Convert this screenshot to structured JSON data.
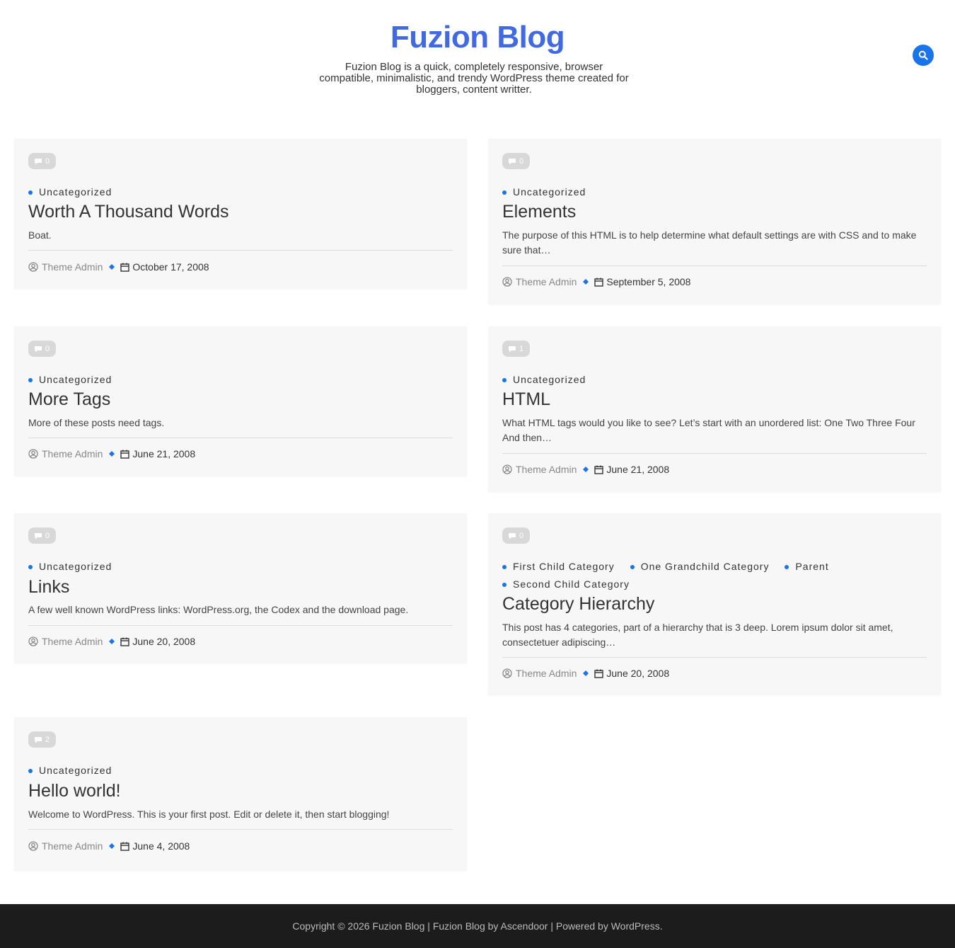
{
  "header": {
    "title": "Fuzion Blog",
    "description": "Fuzion Blog is a quick, completely responsive, browser compatible, minimalistic, and trendy WordPress theme created for bloggers, content writter."
  },
  "posts": [
    {
      "comments": "0",
      "categories": [
        "Uncategorized"
      ],
      "title": "Worth A Thousand Words",
      "excerpt": "Boat.",
      "author": "Theme Admin",
      "date": "October 17, 2008"
    },
    {
      "comments": "0",
      "categories": [
        "Uncategorized"
      ],
      "title": "Elements",
      "excerpt": "The purpose of this HTML is to help determine what default settings are with CSS and to make sure that…",
      "author": "Theme Admin",
      "date": "September 5, 2008"
    },
    {
      "comments": "0",
      "categories": [
        "Uncategorized"
      ],
      "title": "More Tags",
      "excerpt": "More of these posts need tags.",
      "author": "Theme Admin",
      "date": "June 21, 2008"
    },
    {
      "comments": "1",
      "categories": [
        "Uncategorized"
      ],
      "title": "HTML",
      "excerpt": "What HTML tags would you like to see? Let’s start with an unordered list: One Two Three Four And then…",
      "author": "Theme Admin",
      "date": "June 21, 2008"
    },
    {
      "comments": "0",
      "categories": [
        "Uncategorized"
      ],
      "title": "Links",
      "excerpt": "A few well known WordPress links: WordPress.org, the Codex and the download page.",
      "author": "Theme Admin",
      "date": "June 20, 2008"
    },
    {
      "comments": "0",
      "categories": [
        "First Child Category",
        "One Grandchild Category",
        "Parent",
        "Second Child Category"
      ],
      "title": "Category Hierarchy",
      "excerpt": "This post has 4 categories, part of a hierarchy that is 3 deep. Lorem ipsum dolor sit amet, consectetuer adipiscing…",
      "author": "Theme Admin",
      "date": "June 20, 2008"
    },
    {
      "comments": "2",
      "categories": [
        "Uncategorized"
      ],
      "title": "Hello world!",
      "excerpt": "Welcome to WordPress. This is your first post. Edit or delete it, then start blogging!",
      "author": "Theme Admin",
      "date": "June 4, 2008"
    }
  ],
  "footer": {
    "copyright": "Copyright © 2026 Fuzion Blog",
    "sep1": "|",
    "theme_credit": "Fuzion Blog by Ascendoor",
    "sep2": "|",
    "powered": "Powered by WordPress."
  },
  "colors": {
    "accent": "#1874e8",
    "title": "#4169e1",
    "card_bg": "#f7f7f7",
    "footer_bg": "#1c1c1c"
  },
  "icons": {
    "search": "search-icon",
    "comment": "comment-icon",
    "author": "user-circle-icon",
    "date": "calendar-icon",
    "separator": "diamond-icon"
  }
}
